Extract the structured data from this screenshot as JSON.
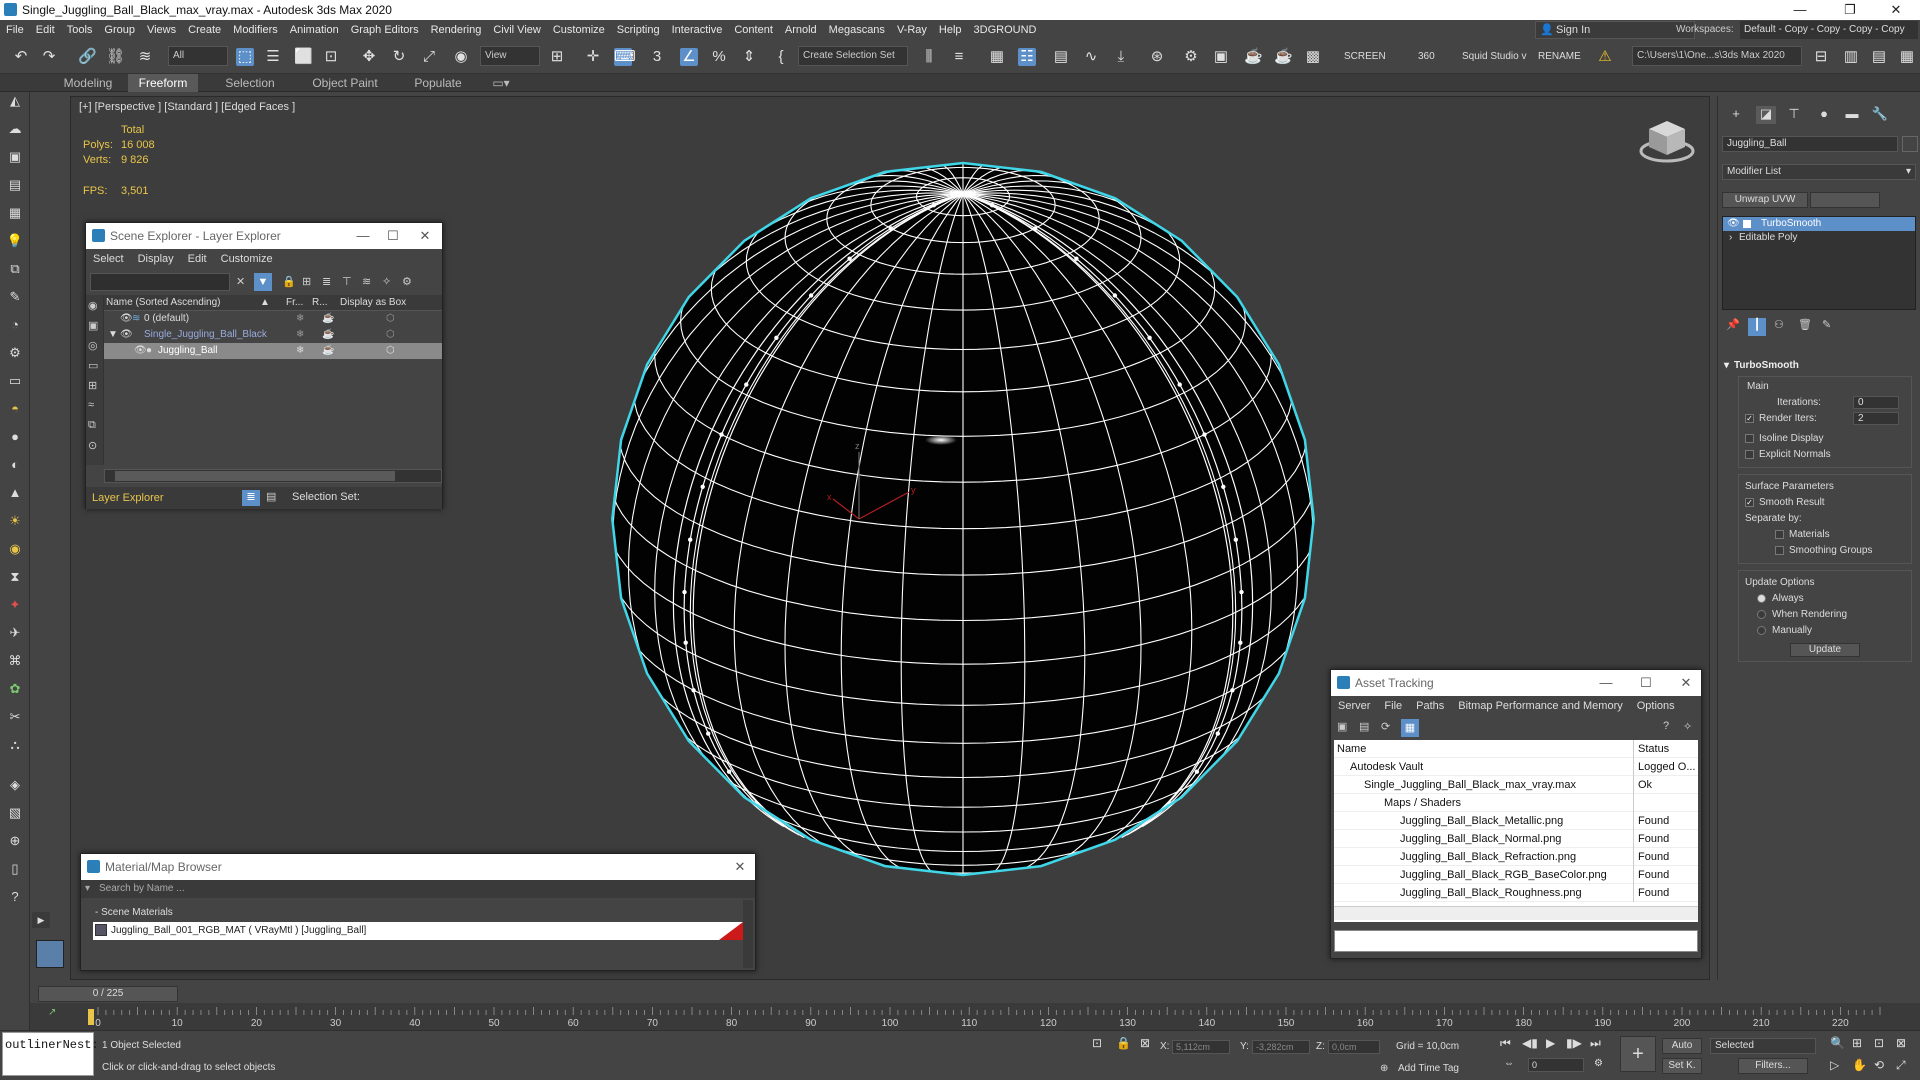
{
  "title": "Single_Juggling_Ball_Black_max_vray.max - Autodesk 3ds Max 2020",
  "menu": [
    "File",
    "Edit",
    "Tools",
    "Group",
    "Views",
    "Create",
    "Modifiers",
    "Animation",
    "Graph Editors",
    "Rendering",
    "Civil View",
    "Customize",
    "Scripting",
    "Interactive",
    "Content",
    "Arnold",
    "Megascans",
    "V-Ray",
    "Help",
    "3DGROUND"
  ],
  "signin": "Sign In",
  "workspaces_label": "Workspaces:",
  "workspaces_value": "Default - Copy - Copy - Copy - Copy",
  "toolbar": {
    "filter": "All",
    "ref_coord": "View",
    "selection_set": "Create Selection Set",
    "screen": "SCREEN",
    "deg": "360",
    "squid": "Squid Studio v",
    "rename": "RENAME",
    "path": "C:\\Users\\1\\One...s\\3ds Max 2020"
  },
  "ribbon_tabs": [
    "Modeling",
    "Freeform",
    "Selection",
    "Object Paint",
    "Populate"
  ],
  "viewport": {
    "label": "[+] [Perspective ] [Standard ] [Edged Faces ]",
    "total": "Total",
    "polys_label": "Polys:",
    "polys": "16 008",
    "verts_label": "Verts:",
    "verts": "9 826",
    "fps_label": "FPS:",
    "fps": "3,501",
    "axis_x": "x",
    "axis_y": "y",
    "axis_z": "z"
  },
  "scene_explorer": {
    "title": "Scene Explorer - Layer Explorer",
    "menu": [
      "Select",
      "Display",
      "Edit",
      "Customize"
    ],
    "col_name": "Name (Sorted Ascending)",
    "col_fr": "Fr...",
    "col_r": "R...",
    "col_box": "Display as Box",
    "rows": [
      "0 (default)",
      "Single_Juggling_Ball_Black",
      "Juggling_Ball"
    ],
    "footer_dropdown": "Layer Explorer",
    "selection_set": "Selection Set:"
  },
  "material_browser": {
    "title": "Material/Map Browser",
    "search": "Search by Name ...",
    "section": "Scene Materials",
    "item": "Juggling_Ball_001_RGB_MAT  ( VRayMtl )  [Juggling_Ball]"
  },
  "asset_tracking": {
    "title": "Asset Tracking",
    "menu": [
      "Server",
      "File",
      "Paths",
      "Bitmap Performance and Memory",
      "Options"
    ],
    "col_name": "Name",
    "col_status": "Status",
    "rows": [
      {
        "name": "Autodesk Vault",
        "status": "Logged O..."
      },
      {
        "name": "Single_Juggling_Ball_Black_max_vray.max",
        "status": "Ok"
      },
      {
        "name": "Maps / Shaders",
        "status": ""
      },
      {
        "name": "Juggling_Ball_Black_Metallic.png",
        "status": "Found"
      },
      {
        "name": "Juggling_Ball_Black_Normal.png",
        "status": "Found"
      },
      {
        "name": "Juggling_Ball_Black_Refraction.png",
        "status": "Found"
      },
      {
        "name": "Juggling_Ball_Black_RGB_BaseColor.png",
        "status": "Found"
      },
      {
        "name": "Juggling_Ball_Black_Roughness.png",
        "status": "Found"
      }
    ]
  },
  "command_panel": {
    "object_name": "Juggling_Ball",
    "modifier_list": "Modifier List",
    "unwrap": "Unwrap UVW",
    "stack": [
      "TurboSmooth",
      "Editable Poly"
    ],
    "rollout_title": "TurboSmooth",
    "main": "Main",
    "iterations_label": "Iterations:",
    "iterations": "0",
    "render_iters_label": "Render Iters:",
    "render_iters": "2",
    "isoline": "Isoline Display",
    "explicit_normals": "Explicit Normals",
    "surface_params": "Surface Parameters",
    "smooth_result": "Smooth Result",
    "separate_by": "Separate by:",
    "materials": "Materials",
    "smoothing_groups": "Smoothing Groups",
    "update_options": "Update Options",
    "always": "Always",
    "when_rendering": "When Rendering",
    "manually": "Manually",
    "update_btn": "Update"
  },
  "timeline": {
    "frame": "0 / 225",
    "ticks": [
      "0",
      "10",
      "20",
      "30",
      "40",
      "50",
      "60",
      "70",
      "80",
      "90",
      "100",
      "110",
      "120",
      "130",
      "140",
      "150",
      "160",
      "170",
      "180",
      "190",
      "200",
      "210",
      "220"
    ]
  },
  "status": {
    "maxscript": "outlinerNest:",
    "selected": "1 Object Selected",
    "prompt": "Click or click-and-drag to select objects",
    "x_label": "X:",
    "x": "5,112cm",
    "y_label": "Y:",
    "y": "-3,282cm",
    "z_label": "Z:",
    "z": "0,0cm",
    "grid": "Grid = 10,0cm",
    "add_time_tag": "Add Time Tag",
    "auto": "Auto",
    "set_key": "Set K.",
    "selected_dd": "Selected",
    "filters": "Filters...",
    "frame_field": "0"
  },
  "colors": {
    "selection_blue": "#5d8fc9",
    "wire": "#ffffff",
    "highlight": "#3fd6e8",
    "stat_yellow": "#e8c54a"
  }
}
